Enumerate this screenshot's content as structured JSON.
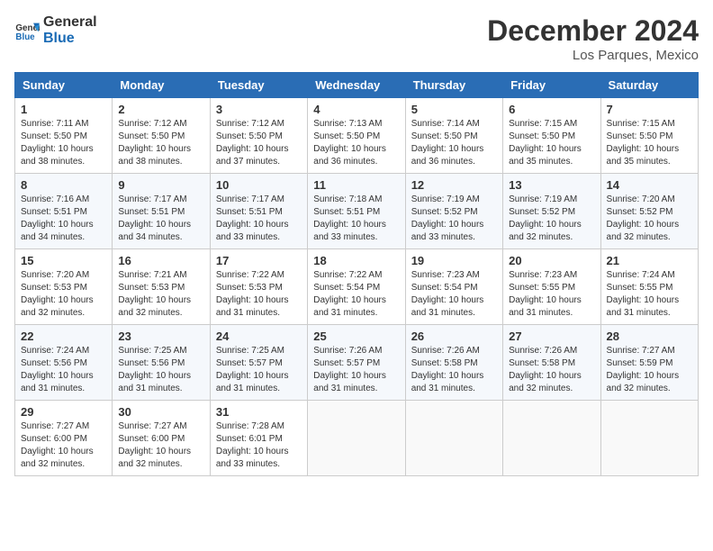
{
  "header": {
    "logo_line1": "General",
    "logo_line2": "Blue",
    "month_title": "December 2024",
    "location": "Los Parques, Mexico"
  },
  "weekdays": [
    "Sunday",
    "Monday",
    "Tuesday",
    "Wednesday",
    "Thursday",
    "Friday",
    "Saturday"
  ],
  "weeks": [
    [
      {
        "day": "1",
        "sunrise": "7:11 AM",
        "sunset": "5:50 PM",
        "daylight": "10 hours and 38 minutes."
      },
      {
        "day": "2",
        "sunrise": "7:12 AM",
        "sunset": "5:50 PM",
        "daylight": "10 hours and 38 minutes."
      },
      {
        "day": "3",
        "sunrise": "7:12 AM",
        "sunset": "5:50 PM",
        "daylight": "10 hours and 37 minutes."
      },
      {
        "day": "4",
        "sunrise": "7:13 AM",
        "sunset": "5:50 PM",
        "daylight": "10 hours and 36 minutes."
      },
      {
        "day": "5",
        "sunrise": "7:14 AM",
        "sunset": "5:50 PM",
        "daylight": "10 hours and 36 minutes."
      },
      {
        "day": "6",
        "sunrise": "7:15 AM",
        "sunset": "5:50 PM",
        "daylight": "10 hours and 35 minutes."
      },
      {
        "day": "7",
        "sunrise": "7:15 AM",
        "sunset": "5:50 PM",
        "daylight": "10 hours and 35 minutes."
      }
    ],
    [
      {
        "day": "8",
        "sunrise": "7:16 AM",
        "sunset": "5:51 PM",
        "daylight": "10 hours and 34 minutes."
      },
      {
        "day": "9",
        "sunrise": "7:17 AM",
        "sunset": "5:51 PM",
        "daylight": "10 hours and 34 minutes."
      },
      {
        "day": "10",
        "sunrise": "7:17 AM",
        "sunset": "5:51 PM",
        "daylight": "10 hours and 33 minutes."
      },
      {
        "day": "11",
        "sunrise": "7:18 AM",
        "sunset": "5:51 PM",
        "daylight": "10 hours and 33 minutes."
      },
      {
        "day": "12",
        "sunrise": "7:19 AM",
        "sunset": "5:52 PM",
        "daylight": "10 hours and 33 minutes."
      },
      {
        "day": "13",
        "sunrise": "7:19 AM",
        "sunset": "5:52 PM",
        "daylight": "10 hours and 32 minutes."
      },
      {
        "day": "14",
        "sunrise": "7:20 AM",
        "sunset": "5:52 PM",
        "daylight": "10 hours and 32 minutes."
      }
    ],
    [
      {
        "day": "15",
        "sunrise": "7:20 AM",
        "sunset": "5:53 PM",
        "daylight": "10 hours and 32 minutes."
      },
      {
        "day": "16",
        "sunrise": "7:21 AM",
        "sunset": "5:53 PM",
        "daylight": "10 hours and 32 minutes."
      },
      {
        "day": "17",
        "sunrise": "7:22 AM",
        "sunset": "5:53 PM",
        "daylight": "10 hours and 31 minutes."
      },
      {
        "day": "18",
        "sunrise": "7:22 AM",
        "sunset": "5:54 PM",
        "daylight": "10 hours and 31 minutes."
      },
      {
        "day": "19",
        "sunrise": "7:23 AM",
        "sunset": "5:54 PM",
        "daylight": "10 hours and 31 minutes."
      },
      {
        "day": "20",
        "sunrise": "7:23 AM",
        "sunset": "5:55 PM",
        "daylight": "10 hours and 31 minutes."
      },
      {
        "day": "21",
        "sunrise": "7:24 AM",
        "sunset": "5:55 PM",
        "daylight": "10 hours and 31 minutes."
      }
    ],
    [
      {
        "day": "22",
        "sunrise": "7:24 AM",
        "sunset": "5:56 PM",
        "daylight": "10 hours and 31 minutes."
      },
      {
        "day": "23",
        "sunrise": "7:25 AM",
        "sunset": "5:56 PM",
        "daylight": "10 hours and 31 minutes."
      },
      {
        "day": "24",
        "sunrise": "7:25 AM",
        "sunset": "5:57 PM",
        "daylight": "10 hours and 31 minutes."
      },
      {
        "day": "25",
        "sunrise": "7:26 AM",
        "sunset": "5:57 PM",
        "daylight": "10 hours and 31 minutes."
      },
      {
        "day": "26",
        "sunrise": "7:26 AM",
        "sunset": "5:58 PM",
        "daylight": "10 hours and 31 minutes."
      },
      {
        "day": "27",
        "sunrise": "7:26 AM",
        "sunset": "5:58 PM",
        "daylight": "10 hours and 32 minutes."
      },
      {
        "day": "28",
        "sunrise": "7:27 AM",
        "sunset": "5:59 PM",
        "daylight": "10 hours and 32 minutes."
      }
    ],
    [
      {
        "day": "29",
        "sunrise": "7:27 AM",
        "sunset": "6:00 PM",
        "daylight": "10 hours and 32 minutes."
      },
      {
        "day": "30",
        "sunrise": "7:27 AM",
        "sunset": "6:00 PM",
        "daylight": "10 hours and 32 minutes."
      },
      {
        "day": "31",
        "sunrise": "7:28 AM",
        "sunset": "6:01 PM",
        "daylight": "10 hours and 33 minutes."
      },
      null,
      null,
      null,
      null
    ]
  ]
}
